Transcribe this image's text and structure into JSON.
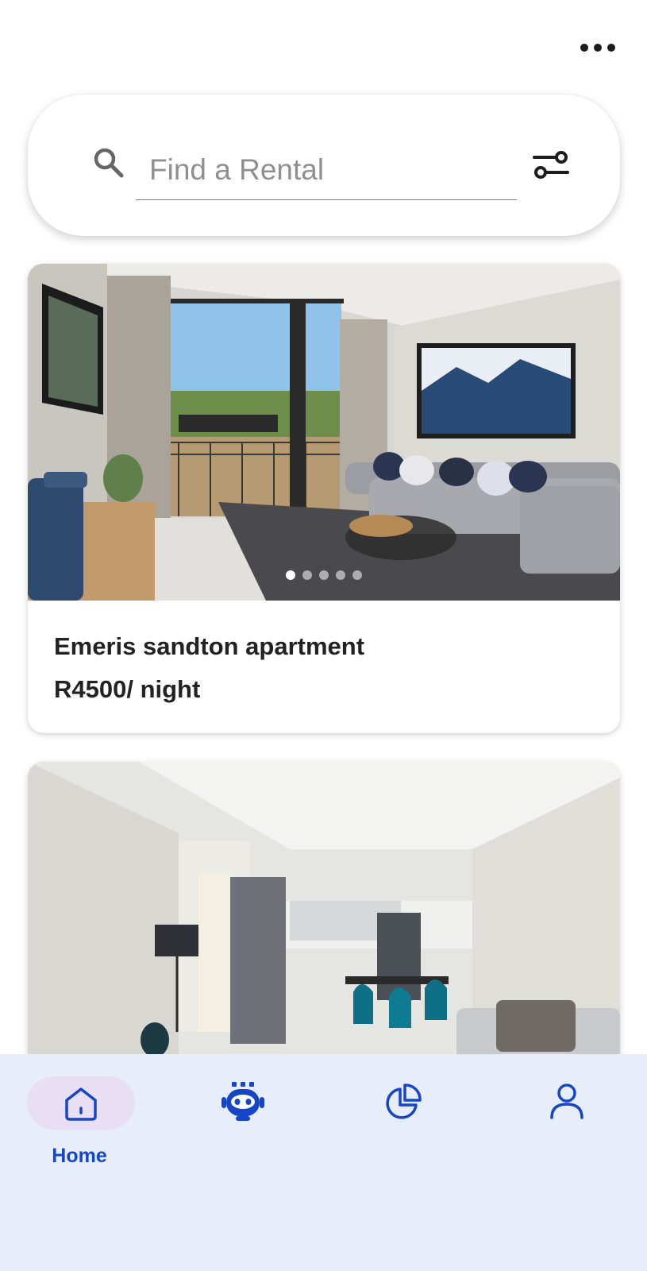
{
  "header": {
    "menu_icon": "more-horizontal-icon"
  },
  "search": {
    "placeholder": "Find a Rental",
    "value": "",
    "search_icon": "search-icon",
    "filter_icon": "filter-sliders-icon"
  },
  "listings": [
    {
      "title": "Emeris sandton apartment",
      "price": "R4500/ night",
      "image": "living-room-with-balcony-photo",
      "carousel": {
        "count": 5,
        "active": 1
      }
    },
    {
      "image": "open-plan-living-kitchen-photo"
    }
  ],
  "bottom_nav": {
    "items": [
      {
        "label": "Home",
        "icon": "home-icon",
        "active": true
      },
      {
        "label": "",
        "icon": "robot-icon",
        "active": false
      },
      {
        "label": "",
        "icon": "pie-chart-icon",
        "active": false
      },
      {
        "label": "",
        "icon": "user-icon",
        "active": false
      }
    ]
  },
  "colors": {
    "nav_background": "#e8edfc",
    "nav_accent": "#1646c8",
    "active_pill": "#e8dff5",
    "text_primary": "#222222"
  }
}
